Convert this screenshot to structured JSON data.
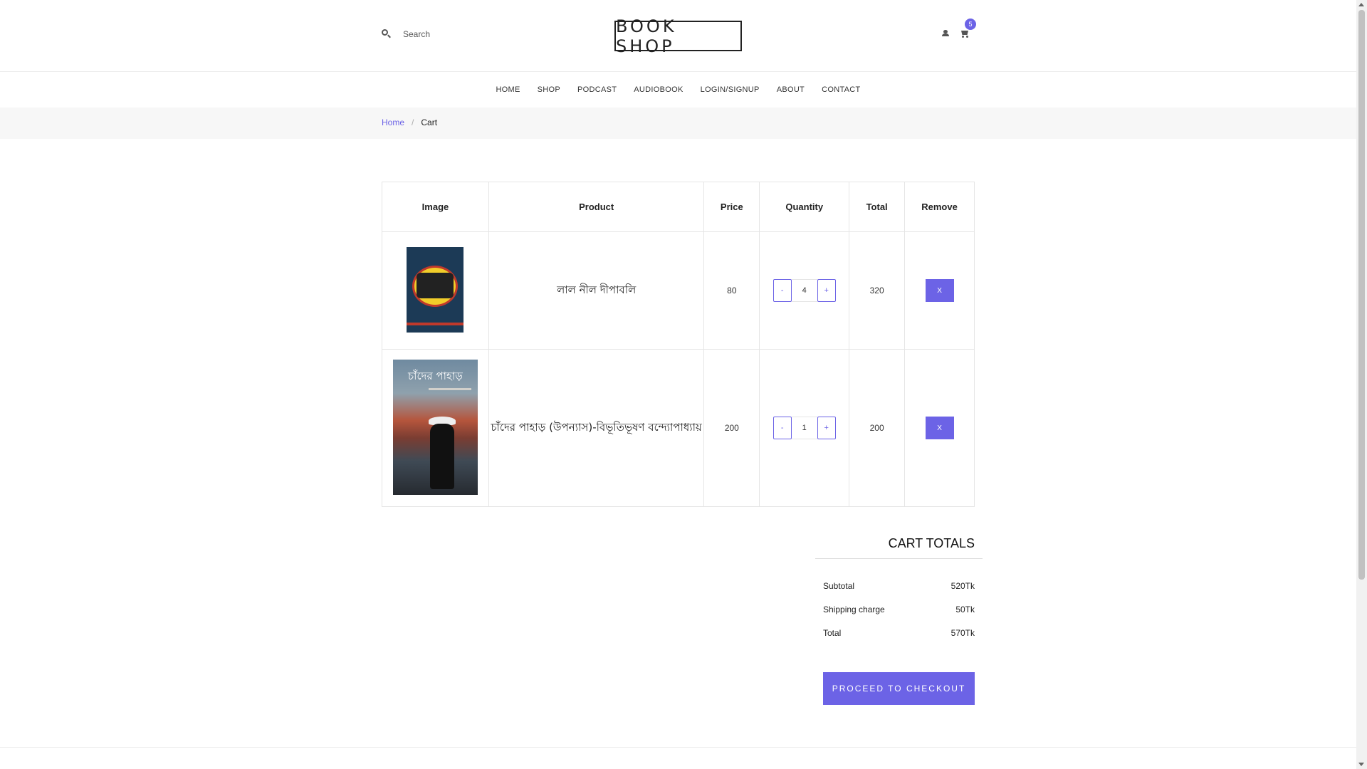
{
  "header": {
    "search_placeholder": "Search",
    "logo": "BOOK SHOP",
    "cart_count": "5",
    "icons": {
      "search": "search-icon",
      "user": "user-icon",
      "cart": "cart-icon"
    }
  },
  "nav": {
    "items": [
      "HOME",
      "SHOP",
      "PODCAST",
      "AUDIOBOOK",
      "LOGIN/SIGNUP",
      "ABOUT",
      "CONTACT"
    ]
  },
  "breadcrumb": {
    "home": "Home",
    "separator": "/",
    "current": "Cart"
  },
  "cart_table": {
    "headers": [
      "Image",
      "Product",
      "Price",
      "Quantity",
      "Total",
      "Remove"
    ],
    "rows": [
      {
        "product": "লাল নীল দীপাবলি",
        "price": "80",
        "quantity": "4",
        "total": "320",
        "remove_label": "X",
        "minus": "-",
        "plus": "+"
      },
      {
        "product": "চাঁদের পাহাড় (উপন্যাস)-বিভূতিভূষণ বন্দ্যোপাধ্যায়",
        "price": "200",
        "quantity": "1",
        "total": "200",
        "remove_label": "X",
        "minus": "-",
        "plus": "+",
        "cover_title": "চাঁদের পাহাড়"
      }
    ]
  },
  "cart_totals": {
    "title": "CART TOTALS",
    "subtotal_label": "Subtotal",
    "subtotal_value": "520Tk",
    "shipping_label": "Shipping charge",
    "shipping_value": "50Tk",
    "total_label": "Total",
    "total_value": "570Tk",
    "checkout_label": "PROCEED TO CHECKOUT"
  },
  "colors": {
    "accent": "#6c63e6",
    "border": "#e5e5e5",
    "breadcrumb_bg": "#f7f7f7"
  }
}
